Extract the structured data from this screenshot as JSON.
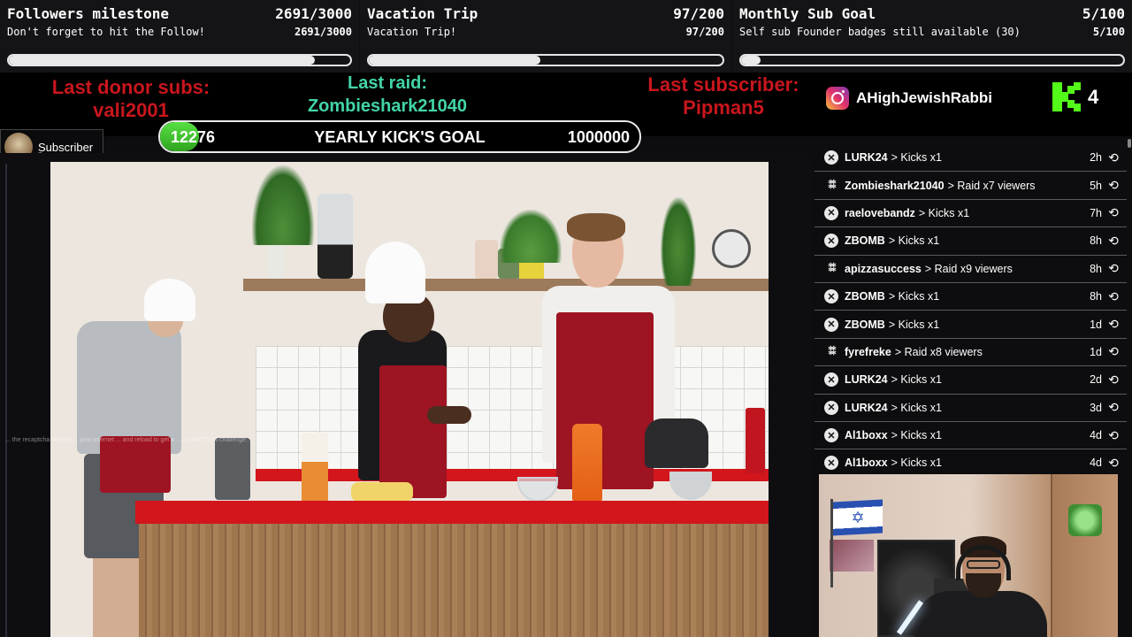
{
  "goals": [
    {
      "title": "Followers milestone",
      "count": "2691/3000",
      "subtitle": "Don't forget to hit the Follow!",
      "progress": 0.897
    },
    {
      "title": "Vacation Trip",
      "count": "97/200",
      "subtitle": "Vacation Trip!",
      "progress": 0.485
    },
    {
      "title": "Monthly Sub Goal",
      "count": "5/100",
      "subtitle": "Self sub Founder badges still available (30)",
      "progress": 0.05
    }
  ],
  "last_donor": {
    "label": "Last donor subs:",
    "name": "vali2001"
  },
  "last_raid": {
    "label": "Last raid:",
    "name": "Zombieshark21040"
  },
  "last_subscriber": {
    "label": "Last subscriber:",
    "name": "Pipman5"
  },
  "instagram": {
    "handle": "AHighJewishRabbi",
    "icon": "instagram-icon"
  },
  "kick": {
    "count": "4",
    "icon": "kick-logo-icon"
  },
  "yearly_goal": {
    "current": "12276",
    "title": "YEARLY KICK'S GOAL",
    "target": "1000000",
    "progress": 0.0123
  },
  "sub_badge": {
    "label": "Subscriber",
    "small": "7"
  },
  "video": {
    "watermark": "... the recaptcha service ... your internet ... and reload to get a ... reCAPTCHA challenge."
  },
  "events": [
    {
      "type": "kicks",
      "user": "LURK24",
      "action": "> Kicks x1",
      "time": "2h"
    },
    {
      "type": "raid",
      "user": "Zombieshark21040",
      "action": "> Raid x7 viewers",
      "time": "5h"
    },
    {
      "type": "kicks",
      "user": "raelovebandz",
      "action": "> Kicks x1",
      "time": "7h"
    },
    {
      "type": "kicks",
      "user": "ZBOMB",
      "action": "> Kicks x1",
      "time": "8h"
    },
    {
      "type": "raid",
      "user": "apizzasuccess",
      "action": "> Raid x9 viewers",
      "time": "8h"
    },
    {
      "type": "kicks",
      "user": "ZBOMB",
      "action": "> Kicks x1",
      "time": "8h"
    },
    {
      "type": "kicks",
      "user": "ZBOMB",
      "action": "> Kicks x1",
      "time": "1d"
    },
    {
      "type": "raid",
      "user": "fyrefreke",
      "action": "> Raid x8 viewers",
      "time": "1d"
    },
    {
      "type": "kicks",
      "user": "LURK24",
      "action": "> Kicks x1",
      "time": "2d"
    },
    {
      "type": "kicks",
      "user": "LURK24",
      "action": "> Kicks x1",
      "time": "3d"
    },
    {
      "type": "kicks",
      "user": "Al1boxx",
      "action": "> Kicks x1",
      "time": "4d"
    },
    {
      "type": "kicks",
      "user": "Al1boxx",
      "action": "> Kicks x1",
      "time": "4d"
    }
  ],
  "colors": {
    "red": "#c8161d",
    "green": "#42d4a8",
    "kick_green": "#53fc18"
  }
}
